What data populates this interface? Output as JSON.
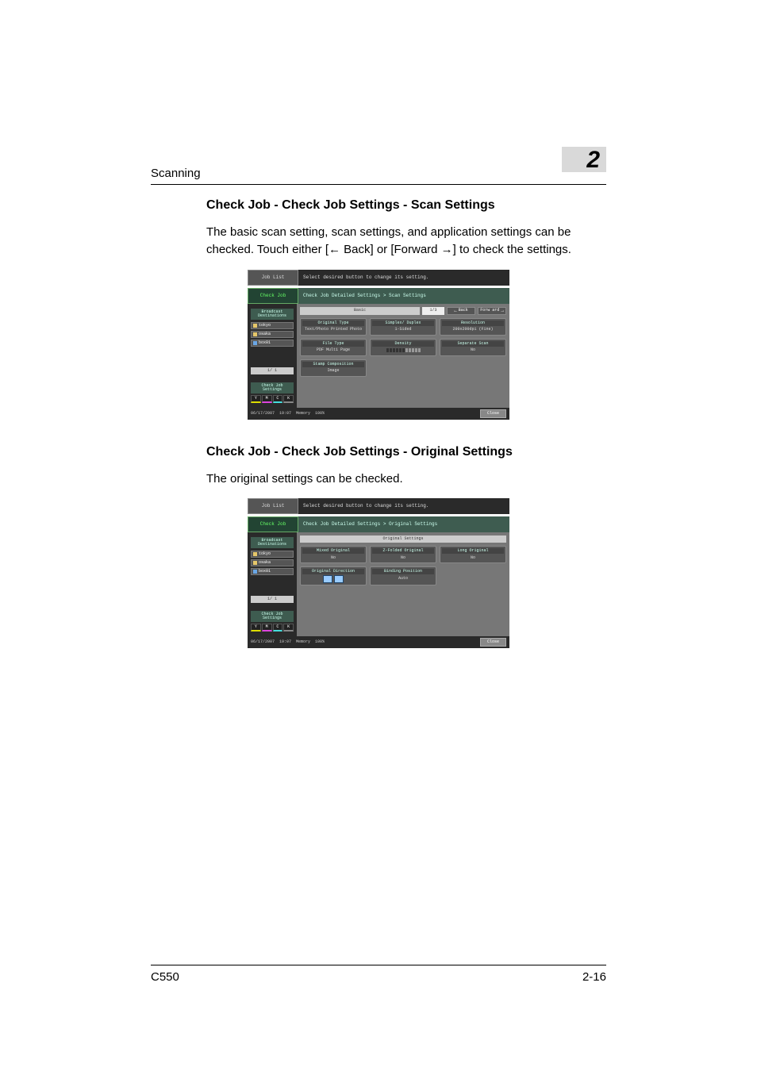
{
  "page": {
    "running_head": "Scanning",
    "chapter_number": "2",
    "footer_left": "C550",
    "footer_right": "2-16"
  },
  "section1": {
    "heading": "Check Job - Check Job Settings - Scan Settings",
    "para": "The basic scan setting, scan settings, and application settings can be checked. Touch either [← Back] or [Forward →] to check the settings."
  },
  "section2": {
    "heading": "Check Job - Check Job Settings - Original Settings",
    "para": "The original settings can be checked."
  },
  "shot_common": {
    "job_list": "Job List",
    "check_job": "Check Job",
    "instruction": "Select desired button to change its setting.",
    "broadcast": "Broadcast Destinations",
    "dest1": "tokyo",
    "dest2": "osaka",
    "dest3": "box01",
    "pager": "1/  1",
    "check_settings": "Check Job Settings",
    "toner_y": "Y",
    "toner_m": "M",
    "toner_c": "C",
    "toner_k": "K",
    "date": "06/17/2007",
    "time": "19:07",
    "memory_label": "Memory",
    "memory_value": "100%",
    "close": "Close",
    "back": "Back",
    "forward": "Forw ard"
  },
  "shot1": {
    "crumb": "Check Job Detailed Settings > Scan Settings",
    "header_center": "Basic",
    "page_ind": "1/3",
    "tiles": [
      {
        "t": "Original Type",
        "v": "Text/Photo Printed Photo"
      },
      {
        "t": "Simplex/ Duplex",
        "v": "1-Sided"
      },
      {
        "t": "Resolution",
        "v": "200x200dpi (Fine)"
      },
      {
        "t": "File Type",
        "v": "PDF Multi Page"
      },
      {
        "t": "Density",
        "v": "density-bar"
      },
      {
        "t": "Separate Scan",
        "v": "No"
      },
      {
        "t": "Stamp Composition",
        "v": "Image"
      }
    ]
  },
  "shot2": {
    "crumb": "Check Job Detailed Settings > Original Settings",
    "header_center": "Original Settings",
    "tiles": [
      {
        "t": "Mixed Original",
        "v": "No"
      },
      {
        "t": "Z-Folded Original",
        "v": "No"
      },
      {
        "t": "Long Original",
        "v": "No"
      },
      {
        "t": "Original Direction",
        "v": "orient-icons"
      },
      {
        "t": "Binding Position",
        "v": "Auto"
      }
    ]
  }
}
